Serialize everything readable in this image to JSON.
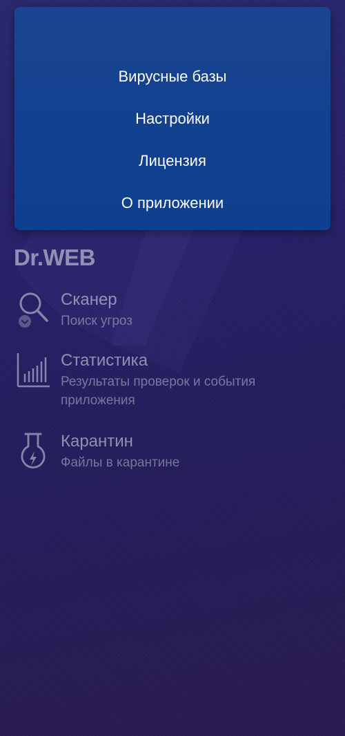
{
  "theme": {
    "background_top": "#2b2870",
    "background_bottom": "#2a1c52",
    "dropdown_bg": "#13418f",
    "text_primary": "#ffffff",
    "text_secondary": "#bdbdd2"
  },
  "dropdown_menu": {
    "items": [
      {
        "label": "Вирусные базы"
      },
      {
        "label": "Настройки"
      },
      {
        "label": "Лицензия"
      },
      {
        "label": "О приложении"
      }
    ]
  },
  "logo": {
    "text": "Dr.WEB"
  },
  "main_menu": {
    "items": [
      {
        "title": "Сканер",
        "subtitle": "Поиск угроз",
        "icon": "scanner-magnifier-icon"
      },
      {
        "title": "Статистика",
        "subtitle": "Результаты проверок и события приложения",
        "icon": "statistics-chart-icon"
      },
      {
        "title": "Карантин",
        "subtitle": "Файлы в карантине",
        "icon": "quarantine-flask-icon"
      }
    ]
  }
}
